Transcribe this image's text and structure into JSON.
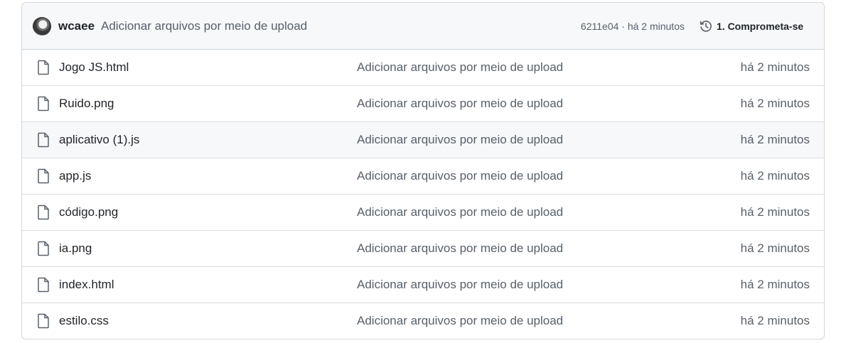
{
  "latest_commit": {
    "author": "wcaee",
    "message": "Adicionar arquivos por meio de upload",
    "meta": "6211e04 · há 2 minutos",
    "history_label": "1. Comprometa-se",
    "history_icon": "history-icon",
    "avatar_icon": "avatar"
  },
  "files": [
    {
      "name": "Jogo JS.html",
      "commit": "Adicionar arquivos por meio de upload",
      "age": "há 2 minutos",
      "icon": "file-icon"
    },
    {
      "name": "Ruido.png",
      "commit": "Adicionar arquivos por meio de upload",
      "age": "há 2 minutos",
      "icon": "file-icon"
    },
    {
      "name": "aplicativo (1).js",
      "commit": "Adicionar arquivos por meio de upload",
      "age": "há 2 minutos",
      "icon": "file-icon"
    },
    {
      "name": "app.js",
      "commit": "Adicionar arquivos por meio de upload",
      "age": "há 2 minutos",
      "icon": "file-icon"
    },
    {
      "name": "código.png",
      "commit": "Adicionar arquivos por meio de upload",
      "age": "há 2 minutos",
      "icon": "file-icon"
    },
    {
      "name": "ia.png",
      "commit": "Adicionar arquivos por meio de upload",
      "age": "há 2 minutos",
      "icon": "file-icon"
    },
    {
      "name": "index.html",
      "commit": "Adicionar arquivos por meio de upload",
      "age": "há 2 minutos",
      "icon": "file-icon"
    },
    {
      "name": "estilo.css",
      "commit": "Adicionar arquivos por meio de upload",
      "age": "há 2 minutos",
      "icon": "file-icon"
    }
  ],
  "colors": {
    "border": "#d0d7de",
    "header_bg": "#f6f8fa",
    "text": "#1f2328",
    "muted": "#57606a"
  }
}
